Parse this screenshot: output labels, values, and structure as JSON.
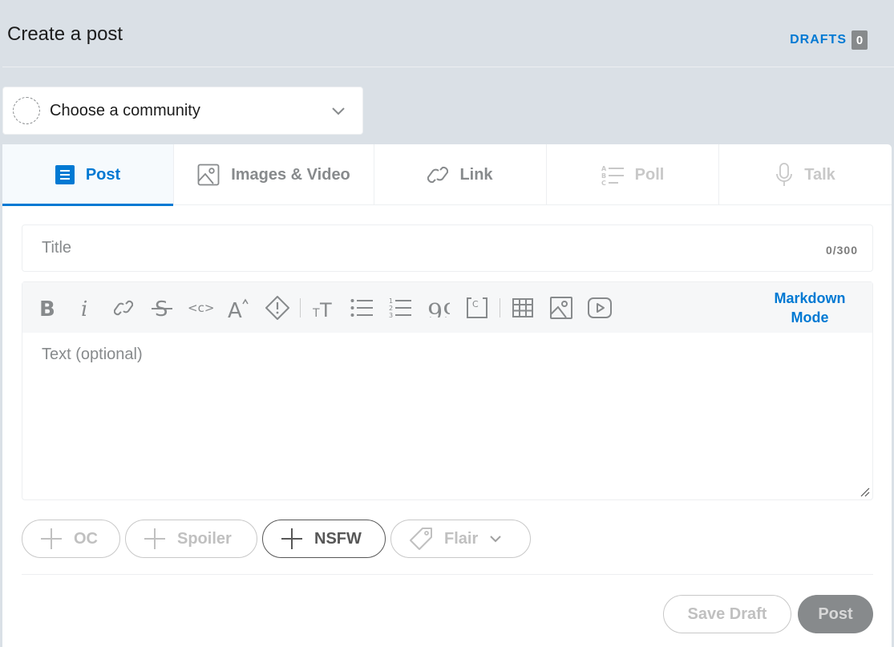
{
  "header": {
    "title": "Create a post",
    "drafts_label": "DRAFTS",
    "drafts_count": "0"
  },
  "community": {
    "label": "Choose a community"
  },
  "tabs": [
    {
      "label": "Post",
      "icon": "post-icon",
      "state": "active"
    },
    {
      "label": "Images & Video",
      "icon": "image-icon",
      "state": "enabled"
    },
    {
      "label": "Link",
      "icon": "link-icon",
      "state": "enabled"
    },
    {
      "label": "Poll",
      "icon": "poll-icon",
      "state": "disabled"
    },
    {
      "label": "Talk",
      "icon": "microphone-icon",
      "state": "disabled"
    }
  ],
  "title_field": {
    "placeholder": "Title",
    "value": "",
    "counter": "0/300"
  },
  "editor": {
    "placeholder": "Text (optional)",
    "value": "",
    "markdown_mode_line1": "Markdown",
    "markdown_mode_line2": "Mode",
    "toolbar_icons": [
      "bold-icon",
      "italic-icon",
      "link-icon",
      "strikethrough-icon",
      "inline-code-icon",
      "superscript-icon",
      "spoiler-icon",
      "heading-icon",
      "bulleted-list-icon",
      "numbered-list-icon",
      "quote-icon",
      "code-block-icon",
      "table-icon",
      "image-icon",
      "video-icon"
    ]
  },
  "tags": {
    "oc": "OC",
    "spoiler": "Spoiler",
    "nsfw": "NSFW",
    "flair": "Flair"
  },
  "actions": {
    "save_draft": "Save Draft",
    "post": "Post"
  },
  "colors": {
    "accent": "#0079d3",
    "background": "#dae0e6",
    "disabled_button": "#878a8c"
  }
}
